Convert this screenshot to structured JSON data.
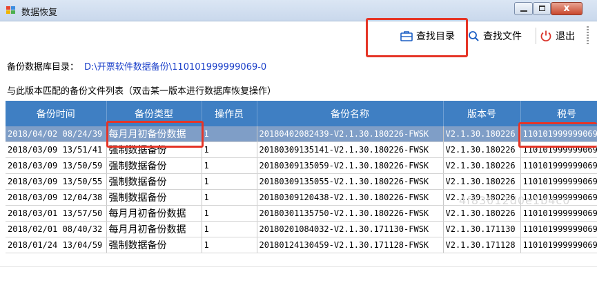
{
  "window": {
    "title": "数据恢复",
    "controls": [
      "minimize",
      "maximize",
      "close"
    ],
    "close_glyph": "x"
  },
  "toolbar": {
    "find_dir_label": "查找目录",
    "find_file_label": "查找文件",
    "exit_label": "退出",
    "icons": {
      "find_dir": "briefcase-icon",
      "find_file": "magnifier-icon",
      "exit": "power-icon"
    },
    "accent_color": "#1c5fc4",
    "exit_color": "#d9342b"
  },
  "backup_dir": {
    "label": "备份数据库目录：",
    "path": "D:\\开票软件数据备份\\110101999999069-0"
  },
  "list_caption": "与此版本匹配的备份文件列表（双击某一版本进行数据库恢复操作）",
  "table": {
    "header_color": "#3f7fc3",
    "selected_color": "#7f9ec7",
    "columns": [
      "备份时间",
      "备份类型",
      "操作员",
      "备份名称",
      "版本号",
      "税号"
    ],
    "rows": [
      {
        "time": "2018/04/02 08/24/39",
        "type": "每月月初备份数据",
        "operator": "1",
        "name": "20180402082439-V2.1.30.180226-FWSK",
        "version": "V2.1.30.180226",
        "tax_id": "110101999999069",
        "selected": true
      },
      {
        "time": "2018/03/09 13/51/41",
        "type": "强制数据备份",
        "operator": "1",
        "name": "20180309135141-V2.1.30.180226-FWSK",
        "version": "V2.1.30.180226",
        "tax_id": "110101999999069",
        "selected": false
      },
      {
        "time": "2018/03/09 13/50/59",
        "type": "强制数据备份",
        "operator": "1",
        "name": "20180309135059-V2.1.30.180226-FWSK",
        "version": "V2.1.30.180226",
        "tax_id": "110101999999069",
        "selected": false
      },
      {
        "time": "2018/03/09 13/50/55",
        "type": "强制数据备份",
        "operator": "1",
        "name": "20180309135055-V2.1.30.180226-FWSK",
        "version": "V2.1.30.180226",
        "tax_id": "110101999999069",
        "selected": false
      },
      {
        "time": "2018/03/09 12/04/38",
        "type": "强制数据备份",
        "operator": "1",
        "name": "20180309120438-V2.1.30.180226-FWSK",
        "version": "V2.1.30.180226",
        "tax_id": "110101999999069",
        "selected": false
      },
      {
        "time": "2018/03/01 13/57/50",
        "type": "每月月初备份数据",
        "operator": "1",
        "name": "20180301135750-V2.1.30.180226-FWSK",
        "version": "V2.1.30.180226",
        "tax_id": "110101999999069",
        "selected": false
      },
      {
        "time": "2018/02/01 08/40/32",
        "type": "每月月初备份数据",
        "operator": "1",
        "name": "20180201084032-V2.1.30.171130-FWSK",
        "version": "V2.1.30.171130",
        "tax_id": "110101999999069",
        "selected": false
      },
      {
        "time": "2018/01/24 13/04/59",
        "type": "强制数据备份",
        "operator": "1",
        "name": "20180124130459-V2.1.30.171128-FWSK",
        "version": "V2.1.30.171128",
        "tax_id": "110101999999069",
        "selected": false
      }
    ]
  },
  "watermark": "4f83012d0e1b4c0",
  "annotation_color": "#e53527"
}
